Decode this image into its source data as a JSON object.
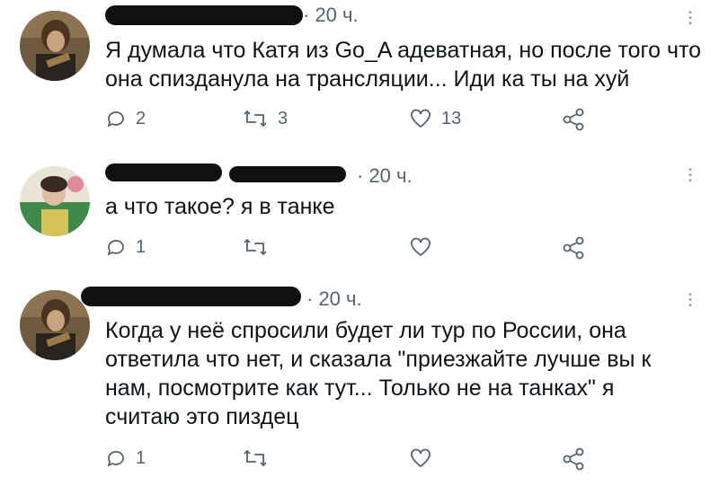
{
  "tweets": [
    {
      "time": "· 20 ч.",
      "text": "Я думала что Катя из Go_A адеватная, но после того что она спизданула на трансляции... Иди ка ты на хуй",
      "replies": "2",
      "retweets": "3",
      "likes": "13"
    },
    {
      "time": "· 20 ч.",
      "text_plain": "а что такое? ",
      "text_highlight": "я в танке",
      "replies": "1",
      "retweets": "",
      "likes": ""
    },
    {
      "time": "· 20 ч.",
      "text_plain": "Когда у неё спросили будет ли тур по России, она ответила что нет, и сказала \"приезжайте лучше вы к нам, посмотрите как тут",
      "text_highlight": "... Только не на танках\"",
      "text_tail": " я считаю это пиздец",
      "replies": "1",
      "retweets": "",
      "likes": ""
    }
  ],
  "colors": {
    "text": "#0f1419",
    "secondary": "#536471",
    "highlight_underline": "#f08a3c",
    "redaction": "#111111"
  },
  "icons": [
    "reply-icon",
    "retweet-icon",
    "like-icon",
    "share-icon",
    "more-icon"
  ]
}
